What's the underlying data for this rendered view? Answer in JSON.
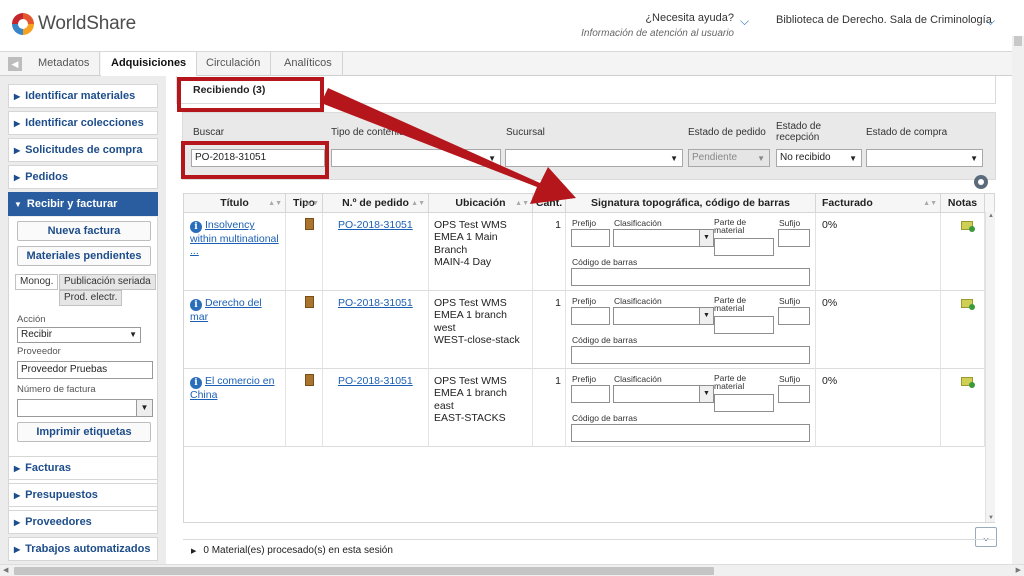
{
  "header": {
    "logo_text": "WorldShare",
    "help_question": "¿Necesita ayuda?",
    "help_sub": "Información de atención al usuario",
    "library": "Biblioteca de Derecho. Sala de Criminología"
  },
  "tabs": [
    "Metadatos",
    "Adquisiciones",
    "Circulación",
    "Analíticos"
  ],
  "sidebar": {
    "items_top": [
      "Identificar materiales",
      "Identificar colecciones",
      "Solicitudes de compra",
      "Pedidos"
    ],
    "open_item": "Recibir y facturar",
    "buttons": {
      "new_invoice": "Nueva factura",
      "pending": "Materiales pendientes",
      "print_labels": "Imprimir etiquetas"
    },
    "subtabs": [
      "Monog.",
      "Publicación seriada",
      "Prod. electr."
    ],
    "action_label": "Acción",
    "action_value": "Recibir",
    "vendor_label": "Proveedor",
    "vendor_value": "Proveedor Pruebas",
    "invoice_label": "Número de factura",
    "items_bottom": [
      "Facturas",
      "Presupuestos",
      "Proveedores",
      "Trabajos automatizados"
    ]
  },
  "receiving": {
    "title": "Recibiendo (3)"
  },
  "filters": {
    "search_label": "Buscar",
    "search_value": "PO-2018-31051",
    "content_type_label": "Tipo de contenido",
    "branch_label": "Sucursal",
    "order_status_label": "Estado de pedido",
    "order_status_value": "Pendiente",
    "receipt_status_label": "Estado de recepción",
    "receipt_status_value": "No recibido",
    "purchase_status_label": "Estado de compra"
  },
  "table": {
    "headers": [
      "Título",
      "Tipo",
      "N.º de pedido",
      "Ubicación",
      "Cant.",
      "Signatura topográfica, código de barras",
      "Facturado",
      "Notas"
    ],
    "field_labels": {
      "prefix": "Prefijo",
      "classification": "Clasificación",
      "part": "Parte de material",
      "suffix": "Sufijo",
      "barcode": "Código de barras"
    },
    "rows": [
      {
        "title": "Insolvency within multinational ...",
        "order": "PO-2018-31051",
        "location": [
          "OPS Test WMS",
          "EMEA 1 Main",
          "Branch",
          "MAIN-4 Day"
        ],
        "qty": "1",
        "invoiced": "0%"
      },
      {
        "title": "Derecho del mar",
        "order": "PO-2018-31051",
        "location": [
          "OPS Test WMS",
          "EMEA 1 branch",
          "west",
          "WEST-close-stack"
        ],
        "qty": "1",
        "invoiced": "0%"
      },
      {
        "title": "El comercio en China",
        "order": "PO-2018-31051",
        "location": [
          "OPS Test WMS",
          "EMEA 1 branch",
          "east",
          "EAST-STACKS"
        ],
        "qty": "1",
        "invoiced": "0%"
      }
    ]
  },
  "processed": "0 Material(es) procesado(s) en esta sesión",
  "colors": {
    "accent": "#2a5d9f",
    "annotation": "#b5161b"
  }
}
